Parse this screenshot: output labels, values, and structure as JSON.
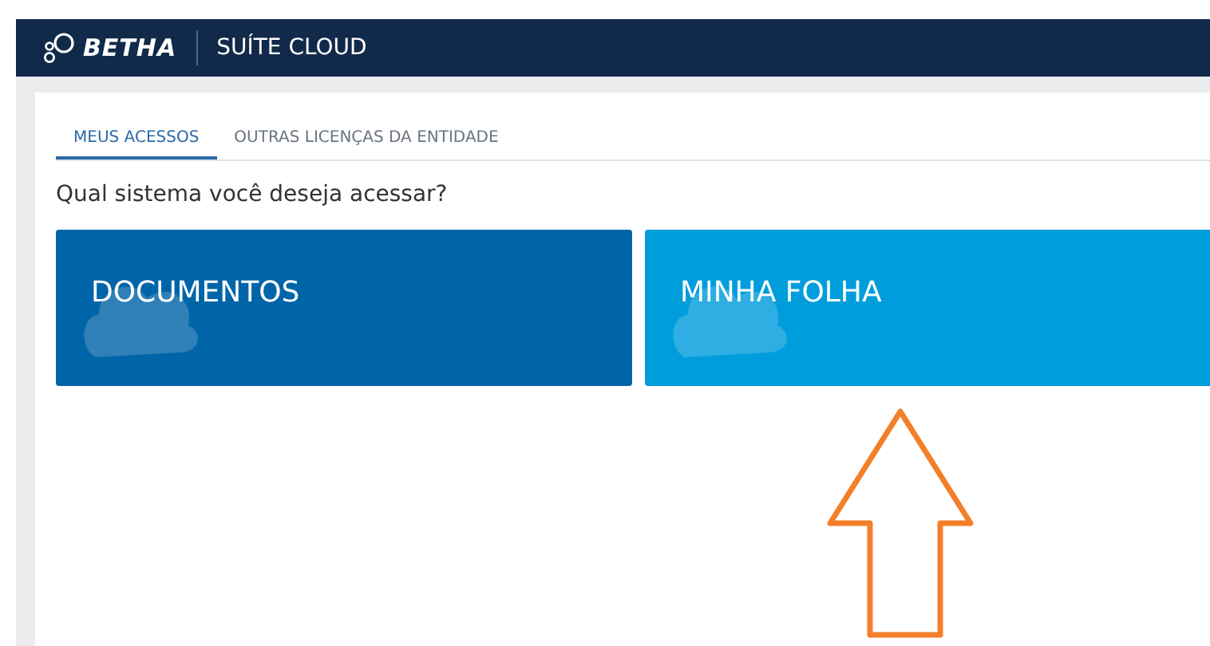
{
  "header": {
    "brand": "BETHA",
    "product": "SUÍTE CLOUD"
  },
  "tabs": [
    {
      "label": "MEUS ACESSOS",
      "selected": true
    },
    {
      "label": "OUTRAS LICENÇAS DA ENTIDADE",
      "selected": false
    }
  ],
  "prompt": "Qual sistema você deseja acessar?",
  "systems": [
    {
      "name": "DOCUMENTOS",
      "color": "#0065a8"
    },
    {
      "name": "MINHA FOLHA",
      "color": "#009ddc"
    }
  ]
}
